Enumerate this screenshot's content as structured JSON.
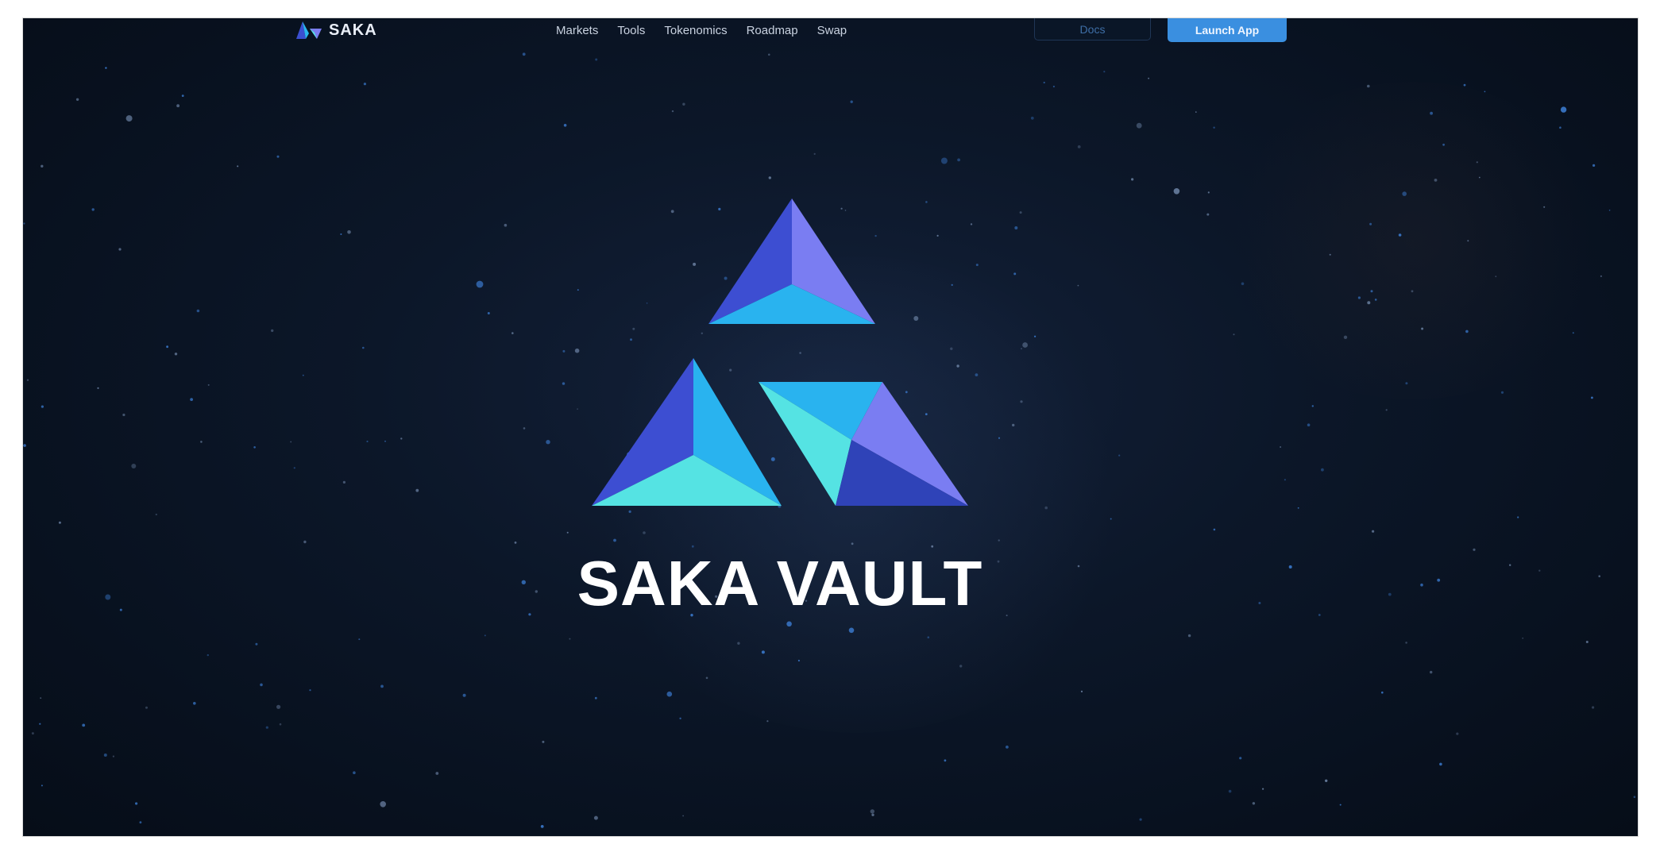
{
  "header": {
    "logo_text": "SAKA",
    "nav": [
      "Markets",
      "Tools",
      "Tokenomics",
      "Roadmap",
      "Swap"
    ],
    "docs_label": "Docs",
    "launch_label": "Launch App"
  },
  "hero": {
    "title": "SAKA VAULT"
  },
  "colors": {
    "background": "#0b1628",
    "accent_blue": "#3a8fe0",
    "triangle_indigo": "#3b4fd0",
    "triangle_violet": "#7a7df0",
    "triangle_cyan": "#29b6ee",
    "triangle_aqua": "#55e3e3"
  }
}
